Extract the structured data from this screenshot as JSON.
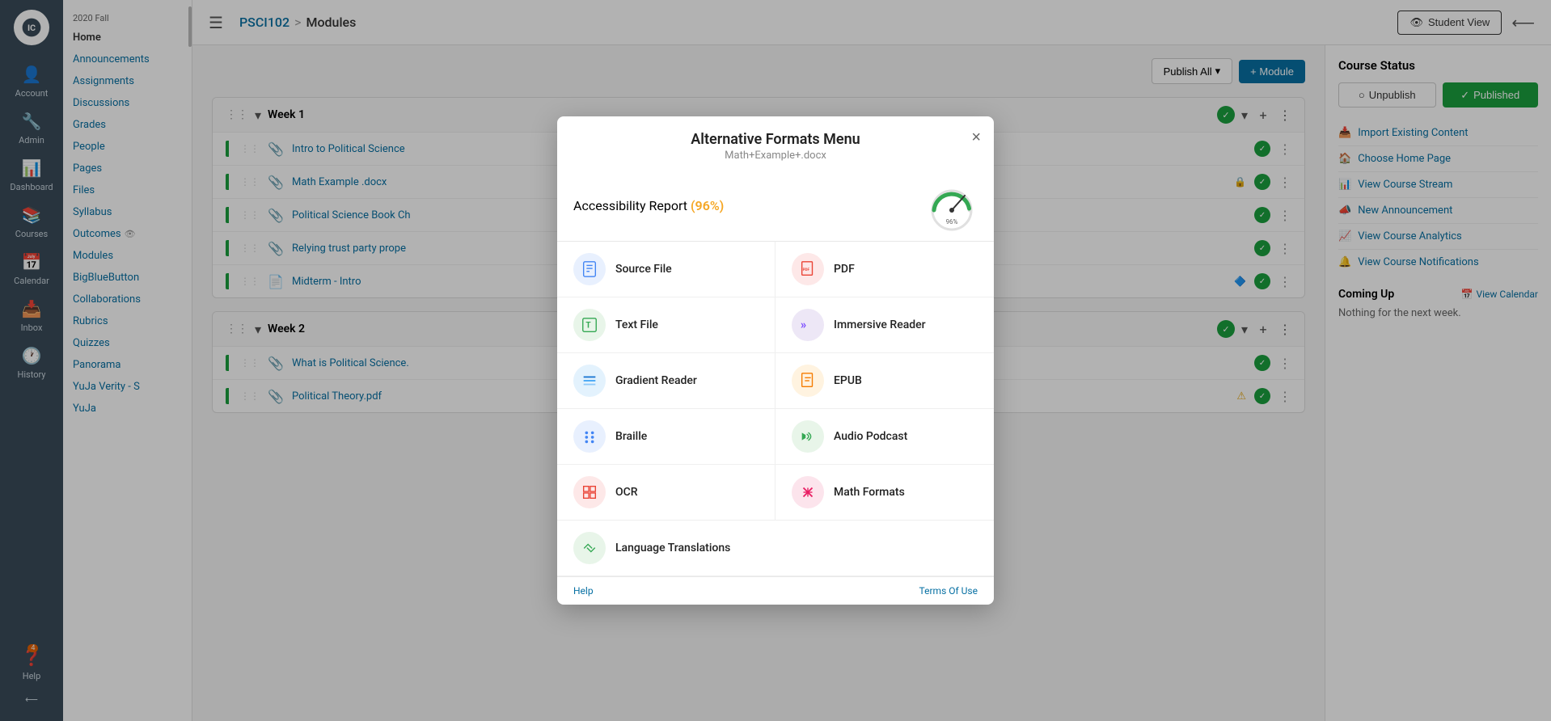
{
  "nav": {
    "items": [
      {
        "label": "Account",
        "icon": "👤",
        "id": "account"
      },
      {
        "label": "Admin",
        "icon": "🔧",
        "id": "admin"
      },
      {
        "label": "Dashboard",
        "icon": "📊",
        "id": "dashboard"
      },
      {
        "label": "Courses",
        "icon": "📚",
        "id": "courses"
      },
      {
        "label": "Calendar",
        "icon": "📅",
        "id": "calendar"
      },
      {
        "label": "Inbox",
        "icon": "📥",
        "id": "inbox"
      },
      {
        "label": "History",
        "icon": "🕐",
        "id": "history"
      },
      {
        "label": "Help",
        "icon": "❓",
        "id": "help",
        "badge": "4"
      }
    ]
  },
  "sidebar": {
    "term": "2020 Fall",
    "links": [
      {
        "label": "Home",
        "active": true
      },
      {
        "label": "Announcements"
      },
      {
        "label": "Assignments"
      },
      {
        "label": "Discussions"
      },
      {
        "label": "Grades"
      },
      {
        "label": "People"
      },
      {
        "label": "Pages"
      },
      {
        "label": "Files"
      },
      {
        "label": "Syllabus"
      },
      {
        "label": "Outcomes"
      },
      {
        "label": "Modules"
      },
      {
        "label": "BigBlueButton"
      },
      {
        "label": "Collaborations"
      },
      {
        "label": "Rubrics"
      },
      {
        "label": "Quizzes"
      },
      {
        "label": "Panorama"
      },
      {
        "label": "YuJa Verity - S"
      },
      {
        "label": "YuJa"
      }
    ]
  },
  "topbar": {
    "course_code": "PSCI102",
    "breadcrumb_sep": ">",
    "current_page": "Modules",
    "student_view_label": "Student View",
    "collapse_icon": "⟵"
  },
  "modules_area": {
    "publish_all_label": "Publish All",
    "add_module_label": "+ Module",
    "weeks": [
      {
        "title": "Week 1",
        "items": [
          {
            "name": "Intro to Political Science",
            "icon": "📎",
            "type": "attachment"
          },
          {
            "name": "Math Example .docx",
            "icon": "📎",
            "type": "attachment",
            "special": "🔒"
          },
          {
            "name": "Political Science Book Ch",
            "icon": "📎",
            "type": "attachment"
          },
          {
            "name": "Relying trust party prope",
            "icon": "📎",
            "type": "attachment"
          },
          {
            "name": "Midterm - Intro",
            "icon": "📄",
            "type": "document",
            "special": "🔷"
          }
        ]
      },
      {
        "title": "Week 2",
        "items": [
          {
            "name": "What is Political Science.",
            "icon": "📎",
            "type": "attachment"
          },
          {
            "name": "Political Theory.pdf",
            "icon": "📎",
            "type": "attachment",
            "warn": true
          }
        ]
      }
    ]
  },
  "right_sidebar": {
    "course_status_title": "Course Status",
    "unpublish_label": "Unpublish",
    "published_label": "Published",
    "links": [
      {
        "icon": "📥",
        "label": "Import Existing Content"
      },
      {
        "icon": "🏠",
        "label": "Choose Home Page"
      },
      {
        "icon": "📊",
        "label": "View Course Stream"
      },
      {
        "icon": "📣",
        "label": "New Announcement"
      },
      {
        "icon": "📈",
        "label": "View Course Analytics"
      },
      {
        "icon": "🔔",
        "label": "View Course Notifications"
      }
    ],
    "coming_up_title": "Coming Up",
    "view_calendar_label": "View Calendar",
    "nothing_text": "Nothing for the next week."
  },
  "modal": {
    "title": "Alternative Formats Menu",
    "subtitle": "Math+Example+.docx",
    "close_label": "×",
    "accessibility_label": "Accessibility Report",
    "accessibility_pct": "(96%)",
    "formats": [
      {
        "id": "source-file",
        "label": "Source File",
        "icon": "📄",
        "bg": "#e8f0fe",
        "color": "#4285f4"
      },
      {
        "id": "pdf",
        "label": "PDF",
        "icon": "📕",
        "bg": "#fde8e8",
        "color": "#ea4335"
      },
      {
        "id": "text-file",
        "label": "Text File",
        "icon": "T",
        "bg": "#e8f5e9",
        "color": "#34a853"
      },
      {
        "id": "immersive-reader",
        "label": "Immersive Reader",
        "icon": "»",
        "bg": "#ede7f6",
        "color": "#7c4dff"
      },
      {
        "id": "gradient-reader",
        "label": "Gradient Reader",
        "icon": "≡",
        "bg": "#e3f2fd",
        "color": "#1976d2"
      },
      {
        "id": "epub",
        "label": "EPUB",
        "icon": "📖",
        "bg": "#fff3e0",
        "color": "#f57c00"
      },
      {
        "id": "braille",
        "label": "Braille",
        "icon": "⠿",
        "bg": "#e8f0fe",
        "color": "#4285f4"
      },
      {
        "id": "audio-podcast",
        "label": "Audio Podcast",
        "icon": "🔊",
        "bg": "#e8f5e9",
        "color": "#34a853"
      },
      {
        "id": "ocr",
        "label": "OCR",
        "icon": "⬡",
        "bg": "#fde8e8",
        "color": "#ea4335"
      },
      {
        "id": "math-formats",
        "label": "Math Formats",
        "icon": "±",
        "bg": "#fce4ec",
        "color": "#e91e63"
      },
      {
        "id": "language-translations",
        "label": "Language Translations",
        "icon": "⇄",
        "bg": "#e8f5e9",
        "color": "#34a853"
      }
    ],
    "footer_help": "Help",
    "footer_terms": "Terms Of Use"
  }
}
